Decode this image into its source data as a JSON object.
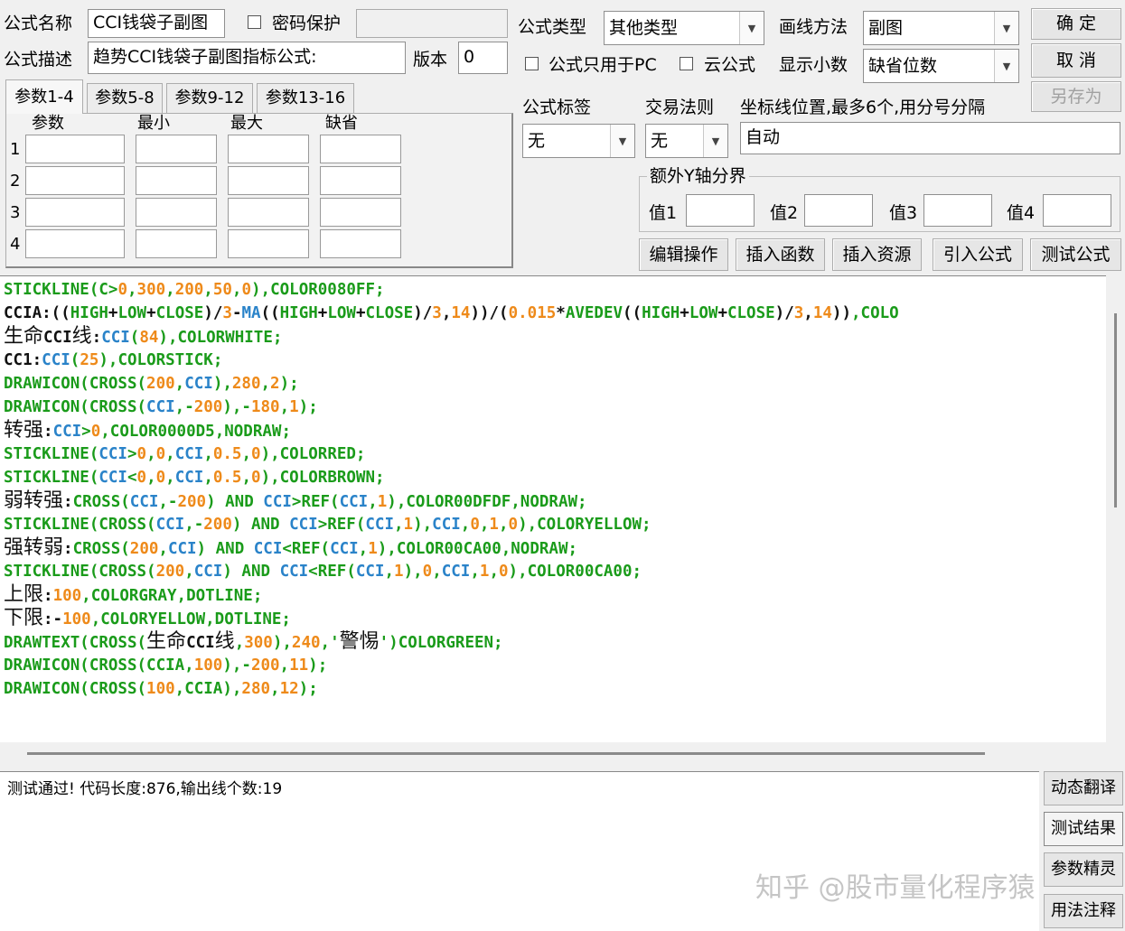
{
  "form": {
    "name_label": "公式名称",
    "name_value": "CCI钱袋子副图",
    "password_label": "密码保护",
    "desc_label": "公式描述",
    "desc_value": "趋势CCI钱袋子副图指标公式:",
    "version_label": "版本",
    "version_value": "0",
    "type_label": "公式类型",
    "type_value": "其他类型",
    "draw_label": "画线方法",
    "draw_value": "副图",
    "pc_only_label": "公式只用于PC",
    "cloud_label": "云公式",
    "decimals_label": "显示小数",
    "decimals_value": "缺省位数",
    "tag_label": "公式标签",
    "tag_value": "无",
    "trade_label": "交易法则",
    "trade_value": "无",
    "axis_label": "坐标线位置,最多6个,用分号分隔",
    "axis_value": "自动",
    "extra_y_label": "额外Y轴分界",
    "v1": "值1",
    "v2": "值2",
    "v3": "值3",
    "v4": "值4"
  },
  "buttons": {
    "ok": "确  定",
    "cancel": "取  消",
    "save_as": "另存为",
    "edit": "编辑操作",
    "insert_func": "插入函数",
    "insert_res": "插入资源",
    "import": "引入公式",
    "test": "测试公式"
  },
  "params": {
    "tabs": [
      "参数1-4",
      "参数5-8",
      "参数9-12",
      "参数13-16"
    ],
    "headers": [
      "参数",
      "最小",
      "最大",
      "缺省"
    ],
    "rows": [
      "1",
      "2",
      "3",
      "4"
    ]
  },
  "code_lines": [
    [
      [
        "STICKLINE(C>",
        "g"
      ],
      [
        "0",
        "o"
      ],
      [
        ",",
        "g"
      ],
      [
        "300",
        "o"
      ],
      [
        ",",
        "g"
      ],
      [
        "200",
        "o"
      ],
      [
        ",",
        "g"
      ],
      [
        "50",
        "o"
      ],
      [
        ",",
        "g"
      ],
      [
        "0",
        "o"
      ],
      [
        "),COLOR0080FF;",
        "g"
      ]
    ],
    [
      [
        "CCIA:((",
        "k"
      ],
      [
        "HIGH",
        "g"
      ],
      [
        "+",
        "k"
      ],
      [
        "LOW",
        "g"
      ],
      [
        "+",
        "k"
      ],
      [
        "CLOSE",
        "g"
      ],
      [
        ")/",
        "k"
      ],
      [
        "3",
        "o"
      ],
      [
        "-",
        "k"
      ],
      [
        "MA",
        "b"
      ],
      [
        "((",
        "k"
      ],
      [
        "HIGH",
        "g"
      ],
      [
        "+",
        "k"
      ],
      [
        "LOW",
        "g"
      ],
      [
        "+",
        "k"
      ],
      [
        "CLOSE",
        "g"
      ],
      [
        ")/",
        "k"
      ],
      [
        "3",
        "o"
      ],
      [
        ",",
        "k"
      ],
      [
        "14",
        "o"
      ],
      [
        "))/(",
        "k"
      ],
      [
        "0.015",
        "o"
      ],
      [
        "*",
        "k"
      ],
      [
        "AVEDEV",
        "g"
      ],
      [
        "((",
        "k"
      ],
      [
        "HIGH",
        "g"
      ],
      [
        "+",
        "k"
      ],
      [
        "LOW",
        "g"
      ],
      [
        "+",
        "k"
      ],
      [
        "CLOSE",
        "g"
      ],
      [
        ")/",
        "k"
      ],
      [
        "3",
        "o"
      ],
      [
        ",",
        "k"
      ],
      [
        "14",
        "o"
      ],
      [
        "))",
        "k"
      ],
      [
        ",COLO",
        "g"
      ]
    ],
    [
      [
        "生命",
        "kcn"
      ],
      [
        "CCI",
        "k"
      ],
      [
        "线",
        "kcn"
      ],
      [
        ":",
        "k"
      ],
      [
        "CCI",
        "b"
      ],
      [
        "(",
        "g"
      ],
      [
        "84",
        "o"
      ],
      [
        "),COLORWHITE;",
        "g"
      ]
    ],
    [
      [
        "CC1:",
        "k"
      ],
      [
        "CCI",
        "b"
      ],
      [
        "(",
        "g"
      ],
      [
        "25",
        "o"
      ],
      [
        "),COLORSTICK;",
        "g"
      ]
    ],
    [
      [
        "DRAWICON(CROSS(",
        "g"
      ],
      [
        "200",
        "o"
      ],
      [
        ",",
        "g"
      ],
      [
        "CCI",
        "b"
      ],
      [
        "),",
        "g"
      ],
      [
        "280",
        "o"
      ],
      [
        ",",
        "g"
      ],
      [
        "2",
        "o"
      ],
      [
        ");",
        "g"
      ]
    ],
    [
      [
        "DRAWICON(CROSS(",
        "g"
      ],
      [
        "CCI",
        "b"
      ],
      [
        ",-",
        "g"
      ],
      [
        "200",
        "o"
      ],
      [
        "),-",
        "g"
      ],
      [
        "180",
        "o"
      ],
      [
        ",",
        "g"
      ],
      [
        "1",
        "o"
      ],
      [
        ");",
        "g"
      ]
    ],
    [
      [
        "转强",
        "kcn"
      ],
      [
        ":",
        "k"
      ],
      [
        "CCI",
        "b"
      ],
      [
        ">",
        "g"
      ],
      [
        "0",
        "o"
      ],
      [
        ",COLOR0000D5,NODRAW;",
        "g"
      ]
    ],
    [
      [
        "STICKLINE(",
        "g"
      ],
      [
        "CCI",
        "b"
      ],
      [
        ">",
        "g"
      ],
      [
        "0",
        "o"
      ],
      [
        ",",
        "g"
      ],
      [
        "0",
        "o"
      ],
      [
        ",",
        "g"
      ],
      [
        "CCI",
        "b"
      ],
      [
        ",",
        "g"
      ],
      [
        "0.5",
        "o"
      ],
      [
        ",",
        "g"
      ],
      [
        "0",
        "o"
      ],
      [
        "),COLORRED;",
        "g"
      ]
    ],
    [
      [
        "STICKLINE(",
        "g"
      ],
      [
        "CCI",
        "b"
      ],
      [
        "<",
        "g"
      ],
      [
        "0",
        "o"
      ],
      [
        ",",
        "g"
      ],
      [
        "0",
        "o"
      ],
      [
        ",",
        "g"
      ],
      [
        "CCI",
        "b"
      ],
      [
        ",",
        "g"
      ],
      [
        "0.5",
        "o"
      ],
      [
        ",",
        "g"
      ],
      [
        "0",
        "o"
      ],
      [
        "),COLORBROWN;",
        "g"
      ]
    ],
    [
      [
        "弱转强",
        "kcn"
      ],
      [
        ":",
        "k"
      ],
      [
        "CROSS(",
        "g"
      ],
      [
        "CCI",
        "b"
      ],
      [
        ",-",
        "g"
      ],
      [
        "200",
        "o"
      ],
      [
        ") AND ",
        "g"
      ],
      [
        "CCI",
        "b"
      ],
      [
        ">REF(",
        "g"
      ],
      [
        "CCI",
        "b"
      ],
      [
        ",",
        "g"
      ],
      [
        "1",
        "o"
      ],
      [
        "),COLOR00DFDF,NODRAW;",
        "g"
      ]
    ],
    [
      [
        "STICKLINE(CROSS(",
        "g"
      ],
      [
        "CCI",
        "b"
      ],
      [
        ",-",
        "g"
      ],
      [
        "200",
        "o"
      ],
      [
        ") AND ",
        "g"
      ],
      [
        "CCI",
        "b"
      ],
      [
        ">REF(",
        "g"
      ],
      [
        "CCI",
        "b"
      ],
      [
        ",",
        "g"
      ],
      [
        "1",
        "o"
      ],
      [
        "),",
        "g"
      ],
      [
        "CCI",
        "b"
      ],
      [
        ",",
        "g"
      ],
      [
        "0",
        "o"
      ],
      [
        ",",
        "g"
      ],
      [
        "1",
        "o"
      ],
      [
        ",",
        "g"
      ],
      [
        "0",
        "o"
      ],
      [
        "),COLORYELLOW;",
        "g"
      ]
    ],
    [
      [
        "强转弱",
        "kcn"
      ],
      [
        ":",
        "k"
      ],
      [
        "CROSS(",
        "g"
      ],
      [
        "200",
        "o"
      ],
      [
        ",",
        "g"
      ],
      [
        "CCI",
        "b"
      ],
      [
        ") AND ",
        "g"
      ],
      [
        "CCI",
        "b"
      ],
      [
        "<REF(",
        "g"
      ],
      [
        "CCI",
        "b"
      ],
      [
        ",",
        "g"
      ],
      [
        "1",
        "o"
      ],
      [
        "),COLOR00CA00,NODRAW;",
        "g"
      ]
    ],
    [
      [
        "STICKLINE(CROSS(",
        "g"
      ],
      [
        "200",
        "o"
      ],
      [
        ",",
        "g"
      ],
      [
        "CCI",
        "b"
      ],
      [
        ") AND ",
        "g"
      ],
      [
        "CCI",
        "b"
      ],
      [
        "<REF(",
        "g"
      ],
      [
        "CCI",
        "b"
      ],
      [
        ",",
        "g"
      ],
      [
        "1",
        "o"
      ],
      [
        "),",
        "g"
      ],
      [
        "0",
        "o"
      ],
      [
        ",",
        "g"
      ],
      [
        "CCI",
        "b"
      ],
      [
        ",",
        "g"
      ],
      [
        "1",
        "o"
      ],
      [
        ",",
        "g"
      ],
      [
        "0",
        "o"
      ],
      [
        "),COLOR00CA00;",
        "g"
      ]
    ],
    [
      [
        "上限",
        "kcn"
      ],
      [
        ":",
        "k"
      ],
      [
        "100",
        "o"
      ],
      [
        ",COLORGRAY,DOTLINE;",
        "g"
      ]
    ],
    [
      [
        "下限",
        "kcn"
      ],
      [
        ":-",
        "k"
      ],
      [
        "100",
        "o"
      ],
      [
        ",COLORYELLOW,DOTLINE;",
        "g"
      ]
    ],
    [
      [
        "DRAWTEXT(CROSS(",
        "g"
      ],
      [
        "生命",
        "kcn"
      ],
      [
        "CCI",
        "k"
      ],
      [
        "线",
        "kcn"
      ],
      [
        ",",
        "g"
      ],
      [
        "300",
        "o"
      ],
      [
        "),",
        "g"
      ],
      [
        "240",
        "o"
      ],
      [
        ",'",
        "g"
      ],
      [
        "警惕",
        "kcn"
      ],
      [
        "')COLORGREEN;",
        "g"
      ]
    ],
    [
      [
        "DRAWICON(CROSS(CCIA,",
        "g"
      ],
      [
        "100",
        "o"
      ],
      [
        "),-",
        "g"
      ],
      [
        "200",
        "o"
      ],
      [
        ",",
        "g"
      ],
      [
        "11",
        "o"
      ],
      [
        ");",
        "g"
      ]
    ],
    [
      [
        "DRAWICON(CROSS(",
        "g"
      ],
      [
        "100",
        "o"
      ],
      [
        ",CCIA),",
        "g"
      ],
      [
        "280",
        "o"
      ],
      [
        ",",
        "g"
      ],
      [
        "12",
        "o"
      ],
      [
        ");",
        "g"
      ]
    ]
  ],
  "colors": {
    "g": "#1a9b1a",
    "o": "#ee8a1a",
    "b": "#2a83c9",
    "k": "#111111",
    "kcn": "#111111"
  },
  "result_text": "测试通过! 代码长度:876,输出线个数:19",
  "side_buttons": [
    "动态翻译",
    "测试结果",
    "参数精灵",
    "用法注释"
  ],
  "watermark": "知乎 @股市量化程序猿"
}
